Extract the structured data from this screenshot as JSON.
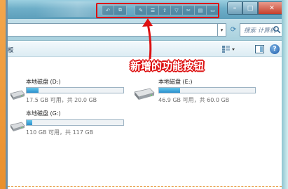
{
  "window": {
    "caption_buttons": {
      "minimize": "–",
      "maximize": "□",
      "close": "✕"
    }
  },
  "address": {
    "dropdown_arrow": "▾",
    "search_placeholder": "搜索 计算机"
  },
  "command_bar": {
    "label": "板",
    "help": "?"
  },
  "annotation": {
    "text": "新增的功能按钮",
    "color": "#dd1111"
  },
  "drives": [
    {
      "name": "本地磁盘 (D:)",
      "free_text": "17.5 GB 可用，共 20.0 GB",
      "used_fraction": 0.125
    },
    {
      "name": "本地磁盘 (E:)",
      "free_text": "46.9 GB 可用，共 60.0 GB",
      "used_fraction": 0.22
    },
    {
      "name": "本地磁盘 (G:)",
      "free_text": "110 GB 可用，共 117 GB",
      "used_fraction": 0.06
    }
  ],
  "colors": {
    "title_bar": "#6eaec8",
    "accent_orange": "#e98f2c",
    "drive_fill": "#2a8fcd",
    "highlight": "#dd1111"
  }
}
